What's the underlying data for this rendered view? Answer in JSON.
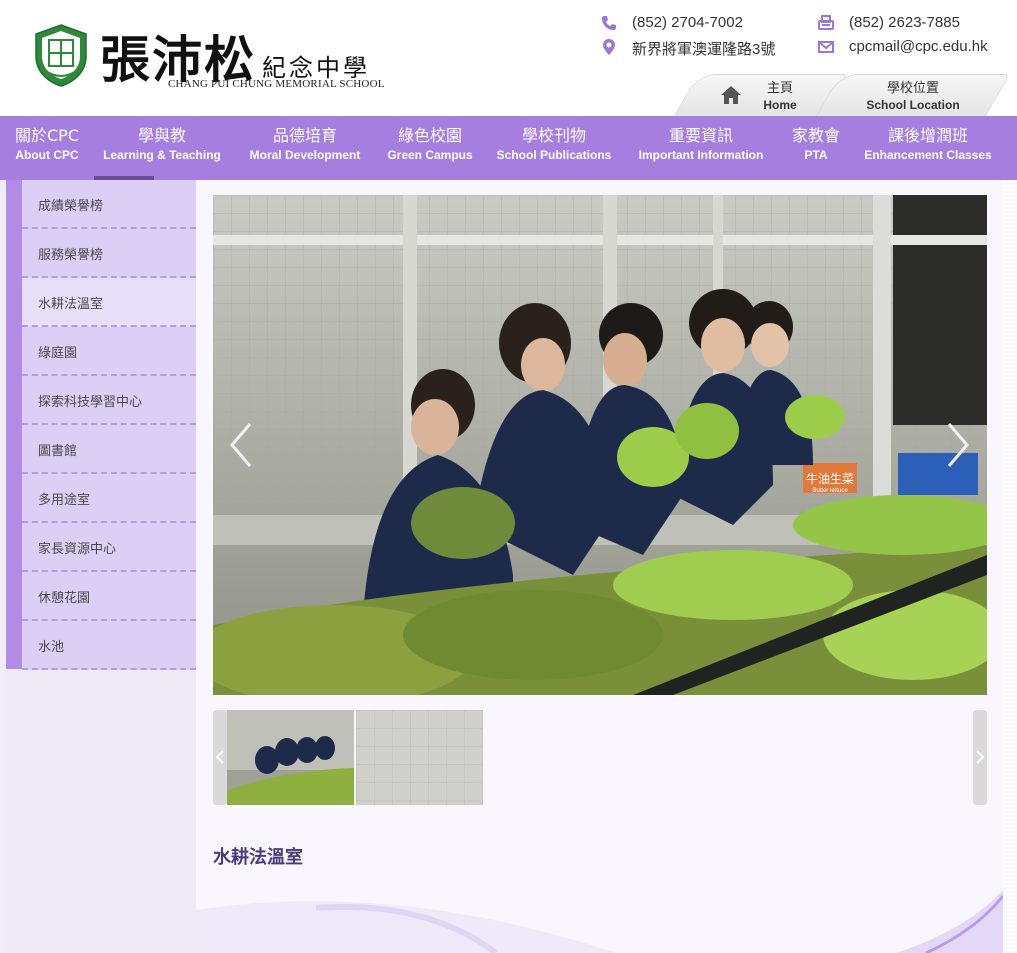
{
  "school": {
    "name_cn_large": "張沛松",
    "name_cn_small": "紀念中學",
    "name_en": "CHANG PUI CHUNG MEMORIAL SCHOOL",
    "emblem_chars": [
      "張",
      "沛",
      "松"
    ]
  },
  "contact": {
    "phone": "(852) 2704-7002",
    "fax": "(852) 2623-7885",
    "address": "新界將軍澳運隆路3號",
    "email": "cpcmail@cpc.edu.hk"
  },
  "top_tabs": [
    {
      "cn": "主頁",
      "en": "Home",
      "icon": "home-icon"
    },
    {
      "cn": "學校位置",
      "en": "School Location"
    }
  ],
  "nav": [
    {
      "cn": "關於CPC",
      "en": "About CPC"
    },
    {
      "cn": "學與教",
      "en": "Learning & Teaching"
    },
    {
      "cn": "品德培育",
      "en": "Moral Development"
    },
    {
      "cn": "綠色校園",
      "en": "Green Campus"
    },
    {
      "cn": "學校刊物",
      "en": "School Publications"
    },
    {
      "cn": "重要資訊",
      "en": "Important Information"
    },
    {
      "cn": "家教會",
      "en": "PTA"
    },
    {
      "cn": "課後增潤班",
      "en": "Enhancement Classes"
    }
  ],
  "sidebar": [
    {
      "label": "成績榮譽榜"
    },
    {
      "label": "服務榮譽榜"
    },
    {
      "label": "水耕法溫室"
    },
    {
      "label": "綠庭園"
    },
    {
      "label": "探索科技學習中心"
    },
    {
      "label": "圖書館"
    },
    {
      "label": "多用途室"
    },
    {
      "label": "家長資源中心"
    },
    {
      "label": "休憩花園"
    },
    {
      "label": "水池"
    }
  ],
  "slideshow": {
    "sign_text": "牛油生菜",
    "sign_text_en": "Butter lettuce"
  },
  "page": {
    "title": "水耕法溫室"
  },
  "colors": {
    "nav_bg": "#a67ee0",
    "sidebar_item": "#dccff5",
    "title": "#4a3b7a",
    "icon": "#9b78d6"
  }
}
